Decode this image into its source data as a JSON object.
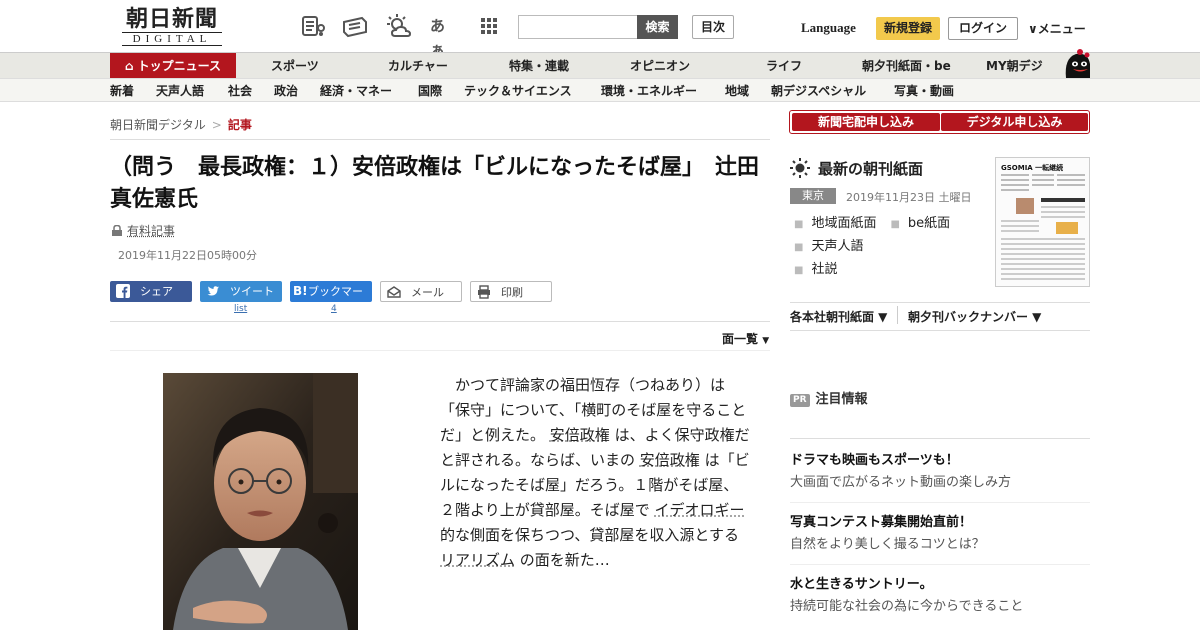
{
  "header": {
    "logo_kanji": "朝日新聞",
    "logo_sub": "DIGITAL",
    "search_button": "検索",
    "toc_button": "目次",
    "language": "Language",
    "signup": "新規登録",
    "login": "ログイン",
    "menu": "∨メニュー",
    "icons": [
      "newspaper-icon",
      "news-ticker-icon",
      "weather-icon",
      "font-size-icon",
      "apps-grid-icon"
    ],
    "font_size_label": "あぁ"
  },
  "nav_primary": [
    "トップニュース",
    "スポーツ",
    "カルチャー",
    "特集・連載",
    "オピニオン",
    "ライフ",
    "朝夕刊紙面・be",
    "MY朝デジ"
  ],
  "nav_secondary": [
    "新着",
    "天声人語",
    "社会",
    "政治",
    "経済・マネー",
    "国際",
    "テック＆サイエンス",
    "環境・エネルギー",
    "地域",
    "朝デジスペシャル",
    "写真・動画"
  ],
  "breadcrumb": {
    "home": "朝日新聞デジタル",
    "sep": ">",
    "current": "記事"
  },
  "article": {
    "title": "（問う　最長政権：１）安倍政権は「ビルになったそば屋」　辻田真佐憲氏",
    "paid_label": "有料記事",
    "date": "2019年11月22日05時00分",
    "share": {
      "facebook": "シェア",
      "twitter": "ツイート",
      "hatena": "ブックマーク",
      "hatena_b": "B!",
      "mail": "メール",
      "print": "印刷",
      "twitter_count": "list",
      "hatena_count": "4"
    },
    "page_list": "面一覧",
    "body_parts": [
      "　かつて評論家の福田恆存（つねあり）は「保守」について、「横町のそば屋を守ることだ」と例えた。",
      "安倍政権",
      "は、よく保守政権だと評される。ならば、いまの",
      "安倍政権",
      "は「ビルになったそば屋」だろう。１階がそば屋、２階より上が貸部屋。そば屋で",
      "イデオロギー",
      "的な側面を保ちつつ、貸部屋を収入源とする",
      "リアリズム",
      "の面を新た…"
    ]
  },
  "sidebar": {
    "delivery_button": "新聞宅配申し込み",
    "digital_button": "デジタル申し込み",
    "paper_title": "最新の朝刊紙面",
    "region": "東京",
    "paper_date": "2019年11月23日 土曜日",
    "paper_links": [
      "地域面紙面",
      "be紙面",
      "天声人語",
      "社説"
    ],
    "thumb_headline": "GSOMIA 一転継続",
    "backnumber_1": "各本社朝刊紙面 ▼",
    "backnumber_2": "朝夕刊バックナンバー ▼",
    "pr_badge": "PR",
    "pr_title": "注目情報",
    "pr_items": [
      {
        "head": "ドラマも映画もスポーツも！",
        "sub": "大画面で広がるネット動画の楽しみ方"
      },
      {
        "head": "写真コンテスト募集開始直前！",
        "sub": "自然をより美しく撮るコツとは？"
      },
      {
        "head": "水と生きるサントリー。",
        "sub": "持続可能な社会の為に今からできること"
      }
    ]
  },
  "colors": {
    "brand_red": "#b3161e",
    "accent_yellow": "#f2c94c",
    "facebook": "#3b5998",
    "twitter": "#3a8dd3",
    "hatena": "#2c7bd6"
  }
}
